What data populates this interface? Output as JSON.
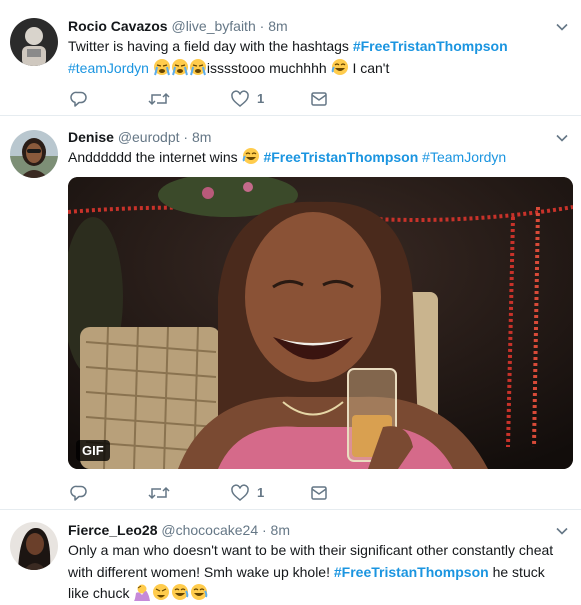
{
  "tweets": [
    {
      "name": "Rocio Cavazos",
      "handle": "@live_byfaith",
      "time": "· 8m",
      "text_1": "Twitter is having a field day with the hashtags ",
      "hashtag_1": "#FreeTristanThompson",
      "hashtag_2": "#teamJordyn",
      "text_2": "isssstooo muchhhh",
      "text_3": " I can't",
      "likes": "1"
    },
    {
      "name": "Denise",
      "handle": "@eurodpt",
      "time": "· 8m",
      "text_1": "Andddddd the internet wins ",
      "hashtag_1": "#FreeTristanThompson",
      "hashtag_2": "#TeamJordyn",
      "media_badge": "GIF",
      "likes": "1"
    },
    {
      "name": "Fierce_Leo28",
      "handle": "@chococake24",
      "time": "· 8m",
      "text_1": "Only a man who doesn't want to be with their significant other constantly cheat with different women! Smh wake up khole!  ",
      "hashtag_1": "#FreeTristanThompson",
      "text_2": " he stuck like chuck "
    }
  ],
  "icons": {
    "reply": "reply-icon",
    "retweet": "retweet-icon",
    "like": "heart-icon",
    "message": "direct-message-icon",
    "caret": "chevron-down-icon"
  },
  "colors": {
    "accent": "#1b95e0",
    "meta": "#657786",
    "text": "#14171a"
  }
}
